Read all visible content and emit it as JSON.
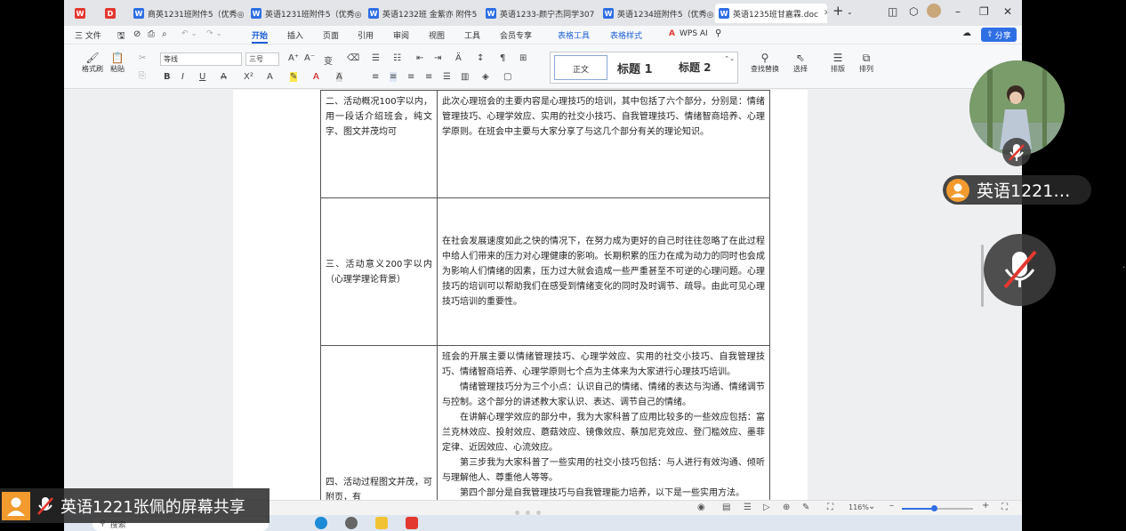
{
  "tabs": [
    {
      "label": "",
      "icon": "wps-logo-icon"
    },
    {
      "label": "",
      "icon": "pdf-icon"
    },
    {
      "label": "商英1231班附件5（优秀◎",
      "icon": "word-doc-icon"
    },
    {
      "label": "英语1231班附件5（优秀◎",
      "icon": "word-doc-icon"
    },
    {
      "label": "英语1232班 金紫亦 附件5",
      "icon": "word-doc-icon"
    },
    {
      "label": "英语1233-颜宁杰同学307",
      "icon": "word-doc-icon"
    },
    {
      "label": "英语1234班附件5（优秀◎",
      "icon": "word-doc-icon"
    },
    {
      "label": "英语1235班甘嘉霖.doc",
      "icon": "word-doc-icon",
      "active": true
    }
  ],
  "menu": {
    "file": "三 文件",
    "items": [
      "开始",
      "插入",
      "页面",
      "引用",
      "审阅",
      "视图",
      "工具",
      "会员专享",
      "表格工具",
      "表格样式"
    ],
    "active": "开始",
    "wps_ai": "WPS AI",
    "share": "分享"
  },
  "ribbon": {
    "format_painter": "格式刷",
    "paste": "粘贴",
    "font_name": "等线",
    "font_size": "三号",
    "style_normal": "正文",
    "style_h1": "标题 1",
    "style_h2": "标题 2",
    "find_replace": "查找替换",
    "select": "选择",
    "sort": "排版",
    "arrange": "排列"
  },
  "document": {
    "rows": [
      {
        "label": "二、活动概况100字以内，用一段话介绍班会，纯文字、图文并茂均可",
        "content": [
          "此次心理班会的主要内容是心理技巧的培训，其中包括了六个部分，分别是：情绪管理技巧、心理学效应、实用的社交小技巧、自我管理技巧、情绪智商培养、心理学原则。在班会中主要与大家分享了与这几个部分有关的理论知识。"
        ]
      },
      {
        "label": "三、活动意义200字以内（心理学理论背景）",
        "content": [
          "在社会发展速度如此之快的情况下，在努力成为更好的自己时往往忽略了在此过程中给人们带来的压力对心理健康的影响。长期积累的压力在成为动力的同时也会成为影响人们情绪的因素，压力过大就会造成一些严重甚至不可逆的心理问题。心理技巧的培训可以帮助我们在感受到情绪变化的同时及时调节、疏导。由此可见心理技巧培训的重要性。"
        ]
      },
      {
        "label": "四、活动过程图文并茂，可附页，有",
        "content": [
          "班会的开展主要以情绪管理技巧、心理学效应、实用的社交小技巧、自我管理技巧、情绪智商培养、心理学原则七个点为主体来为大家进行心理技巧培训。",
          "情绪管理技巧分为三个小点：认识自己的情绪、情绪的表达与沟通、情绪调节与控制。这个部分的讲述教大家认识、表达、调节自己的情绪。",
          "在讲解心理学效应的部分中，我为大家科普了应用比较多的一些效应包括：富兰克林效应、投射效应、蘑菇效应、镜像效应、蔡加尼克效应、登门槛效应、墨菲定律、近因效应、心流效应。",
          "第三步我为大家科普了一些实用的社交小技巧包括：与人进行有效沟通、倾听与理解他人、尊重他人等等。",
          "第四个部分是自我管理技巧与自我管理能力培养，以下是一些实用方法。"
        ]
      }
    ]
  },
  "status": {
    "zoom": "116%",
    "zoom_fraction": 0.45
  },
  "taskbar": {
    "search": "搜索"
  },
  "meeting": {
    "participant_name": "英语1221…",
    "screen_share_label": "英语1221张佩的屏幕共享"
  }
}
